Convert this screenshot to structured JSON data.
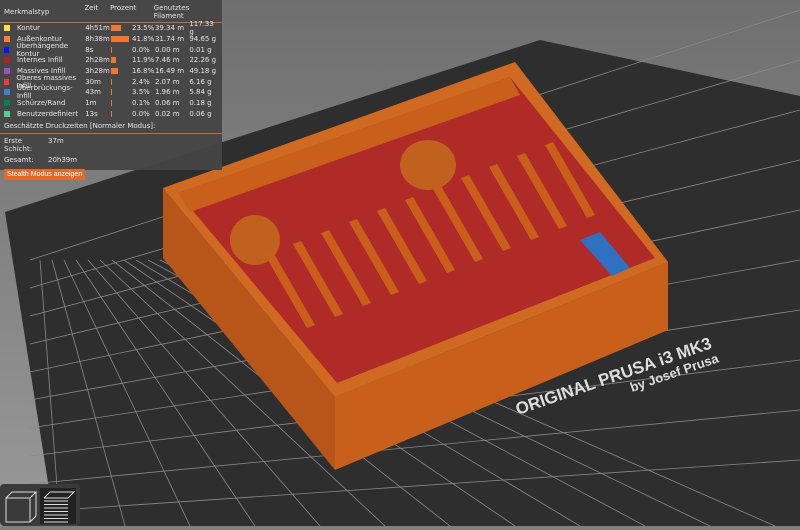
{
  "legend": {
    "headers": [
      "Merkmalstyp",
      "Zeit",
      "Prozent",
      "Genutztes Filament"
    ],
    "rows": [
      {
        "label": "Kontur",
        "time": "4h51m",
        "pct": "23.5%",
        "len": "39.34 m",
        "wt": "117.33 g",
        "color": "#ffe040",
        "frac": 0.235
      },
      {
        "label": "Außenkontur",
        "time": "8h38m",
        "pct": "41.8%",
        "len": "31.74 m",
        "wt": "94.65 g",
        "color": "#ff7d38",
        "frac": 0.418
      },
      {
        "label": "Überhängende Kontur",
        "time": "8s",
        "pct": "0.0%",
        "len": "0.00 m",
        "wt": "0.01 g",
        "color": "#1010ff",
        "frac": 0.0
      },
      {
        "label": "Internes Infill",
        "time": "2h28m",
        "pct": "11.9%",
        "len": "7.46 m",
        "wt": "22.26 g",
        "color": "#b02020",
        "frac": 0.119
      },
      {
        "label": "Massives Infill",
        "time": "3h28m",
        "pct": "16.8%",
        "len": "16.49 m",
        "wt": "49.18 g",
        "color": "#9a50c0",
        "frac": 0.168
      },
      {
        "label": "Oberes massives Infill",
        "time": "30m",
        "pct": "2.4%",
        "len": "2.07 m",
        "wt": "6.16 g",
        "color": "#f03838",
        "frac": 0.024
      },
      {
        "label": "Überbrückungs-Infill",
        "time": "43m",
        "pct": "3.5%",
        "len": "1.96 m",
        "wt": "5.84 g",
        "color": "#4080c8",
        "frac": 0.035
      },
      {
        "label": "Schürze/Rand",
        "time": "1m",
        "pct": "0.1%",
        "len": "0.06 m",
        "wt": "0.18 g",
        "color": "#008060",
        "frac": 0.001
      },
      {
        "label": "Benutzerdefiniert",
        "time": "13s",
        "pct": "0.0%",
        "len": "0.02 m",
        "wt": "0.06 g",
        "color": "#50d090",
        "frac": 0.0
      }
    ],
    "estimate_title": "Geschätzte Druckzeiten [Normaler Modus]:",
    "first_layer_label": "Erste Schicht:",
    "first_layer_value": "37m",
    "total_label": "Gesamt:",
    "total_value": "20h39m",
    "stealth_button": "Stealth Modus anzeigen"
  },
  "bed": {
    "brand": "ORIGINAL PRUSA i3  MK3",
    "maker": "by Josef Prusa"
  }
}
